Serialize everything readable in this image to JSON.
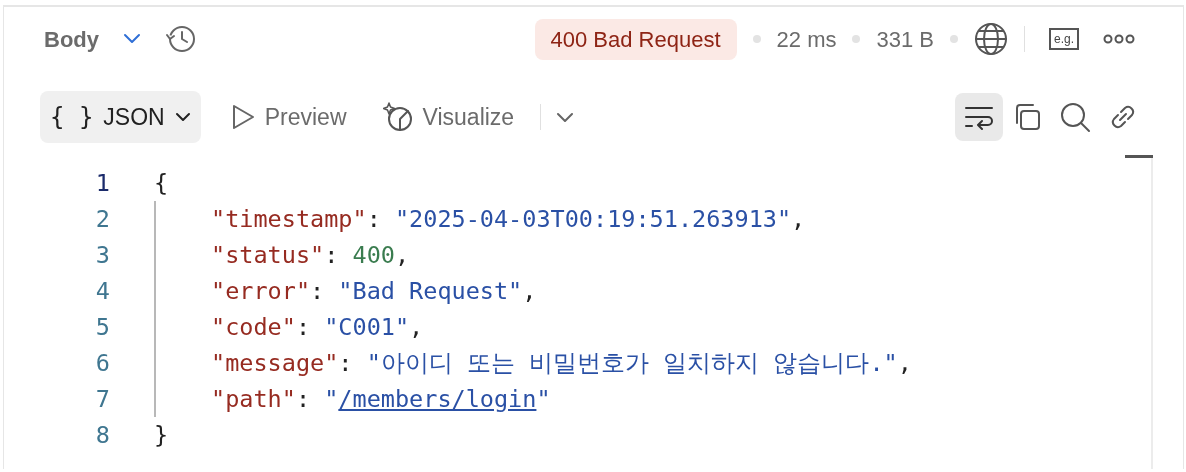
{
  "header": {
    "section": "Body",
    "status": "400 Bad Request",
    "time": "22 ms",
    "size": "331 B",
    "example_label": "e.g."
  },
  "toolbar": {
    "format_icon": "{ }",
    "tabs": [
      {
        "label": "JSON",
        "selected": true,
        "kind": "format"
      },
      {
        "label": "Preview",
        "selected": false,
        "kind": "preview"
      },
      {
        "label": "Visualize",
        "selected": false,
        "kind": "visualize"
      }
    ],
    "wrap_on": true
  },
  "code": {
    "lines": [
      {
        "number": "1",
        "active": true,
        "indented": false,
        "tokens": [
          {
            "kind": "punct",
            "text": "{"
          }
        ]
      },
      {
        "number": "2",
        "active": false,
        "indented": true,
        "tokens": [
          {
            "kind": "key",
            "text": "\"timestamp\""
          },
          {
            "kind": "punct",
            "text": ": "
          },
          {
            "kind": "string",
            "text": "\"2025-04-03T00:19:51.263913\""
          },
          {
            "kind": "punct",
            "text": ","
          }
        ]
      },
      {
        "number": "3",
        "active": false,
        "indented": true,
        "tokens": [
          {
            "kind": "key",
            "text": "\"status\""
          },
          {
            "kind": "punct",
            "text": ": "
          },
          {
            "kind": "number",
            "text": "400"
          },
          {
            "kind": "punct",
            "text": ","
          }
        ]
      },
      {
        "number": "4",
        "active": false,
        "indented": true,
        "tokens": [
          {
            "kind": "key",
            "text": "\"error\""
          },
          {
            "kind": "punct",
            "text": ": "
          },
          {
            "kind": "string",
            "text": "\"Bad Request\""
          },
          {
            "kind": "punct",
            "text": ","
          }
        ]
      },
      {
        "number": "5",
        "active": false,
        "indented": true,
        "tokens": [
          {
            "kind": "key",
            "text": "\"code\""
          },
          {
            "kind": "punct",
            "text": ": "
          },
          {
            "kind": "string",
            "text": "\"C001\""
          },
          {
            "kind": "punct",
            "text": ","
          }
        ]
      },
      {
        "number": "6",
        "active": false,
        "indented": true,
        "tokens": [
          {
            "kind": "key",
            "text": "\"message\""
          },
          {
            "kind": "punct",
            "text": ": "
          },
          {
            "kind": "string",
            "text": "\"아이디 또는 비밀번호가 일치하지 않습니다.\""
          },
          {
            "kind": "punct",
            "text": ","
          }
        ]
      },
      {
        "number": "7",
        "active": false,
        "indented": true,
        "tokens": [
          {
            "kind": "key",
            "text": "\"path\""
          },
          {
            "kind": "punct",
            "text": ": "
          },
          {
            "kind": "string",
            "text": "\""
          },
          {
            "kind": "link",
            "text": "/members/login"
          },
          {
            "kind": "string",
            "text": "\""
          }
        ]
      },
      {
        "number": "8",
        "active": false,
        "indented": false,
        "tokens": [
          {
            "kind": "punct",
            "text": "}"
          }
        ]
      }
    ]
  }
}
